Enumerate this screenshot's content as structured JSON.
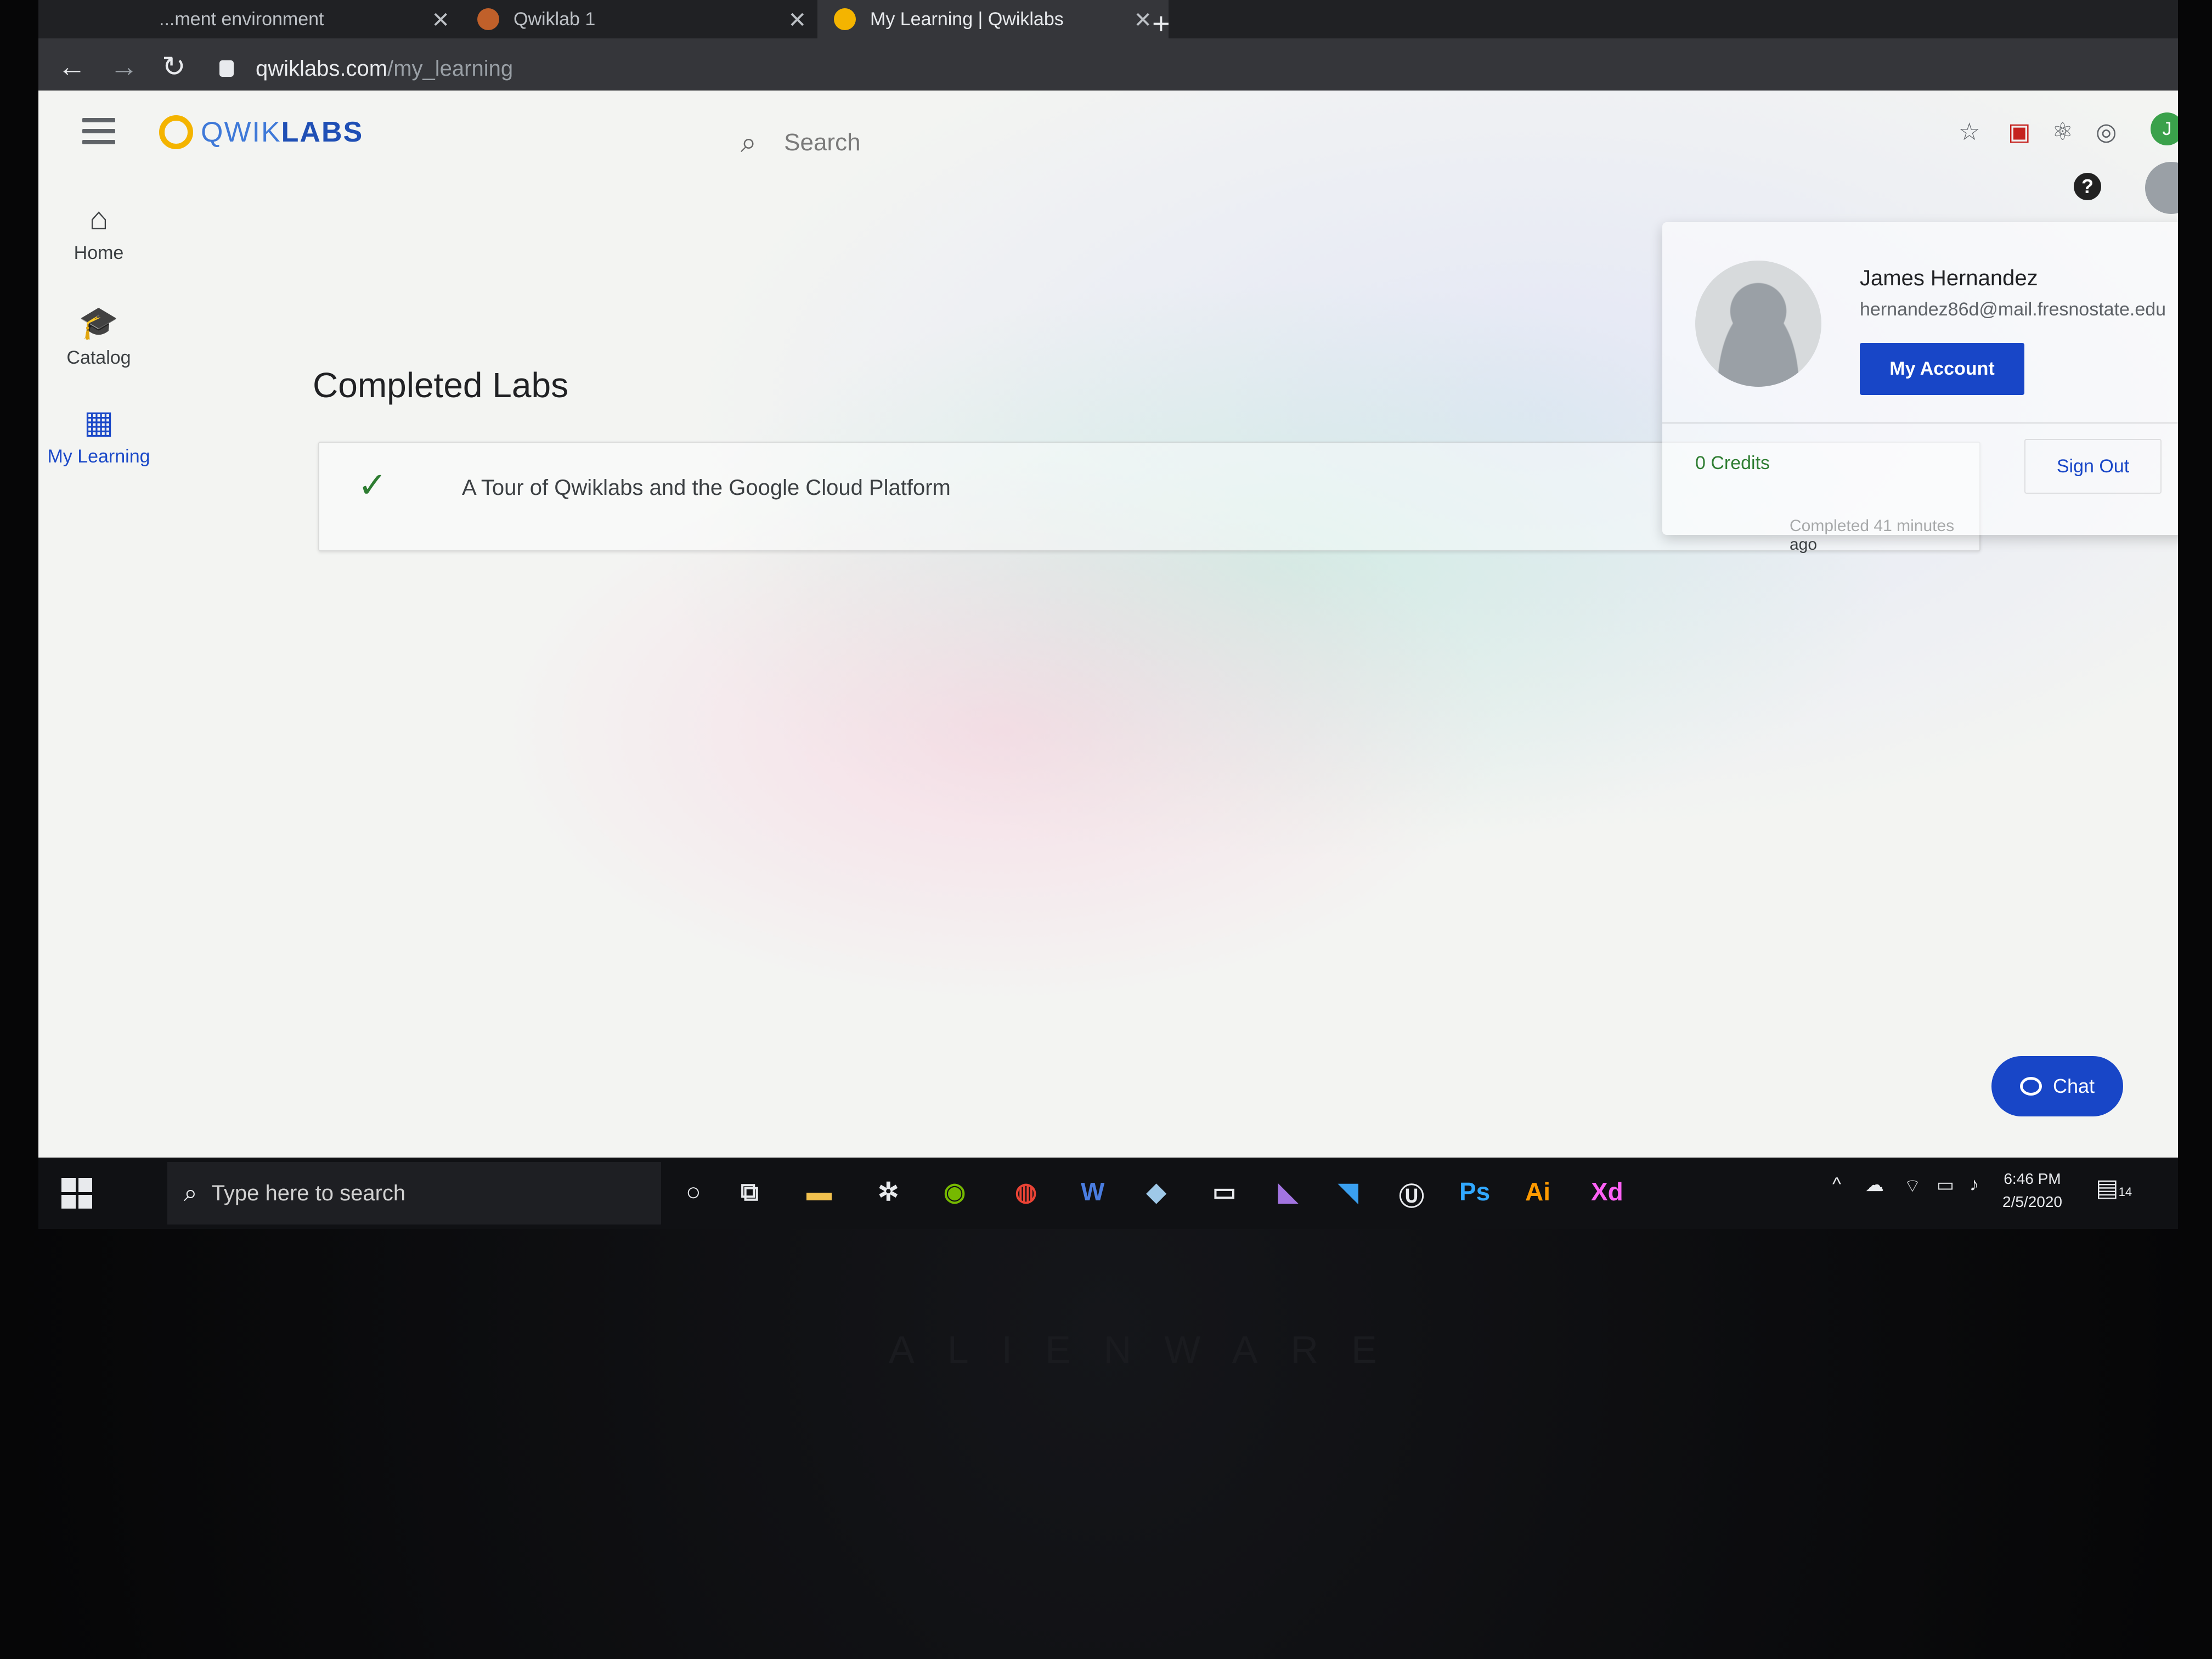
{
  "tabs": [
    {
      "label": "...ment environment",
      "close": "✕"
    },
    {
      "label": "Qwiklab 1",
      "close": "✕"
    },
    {
      "label": "My Learning | Qwiklabs",
      "close": "✕",
      "active": true
    }
  ],
  "new_tab": "+",
  "address": {
    "host": "qwiklabs.com",
    "path": "/my_learning"
  },
  "nav_buttons": {
    "back": "←",
    "forward": "→",
    "reload": "↻"
  },
  "window_controls": {
    "minimize": "—",
    "restore": "❐",
    "close": "✕"
  },
  "profile_initial": "J",
  "app": {
    "logo_light": "QWIK",
    "logo_bold": "LABS",
    "search_placeholder": "Search",
    "help": "?"
  },
  "sidenav": [
    {
      "icon": "home-icon",
      "glyph": "⌂",
      "label": "Home"
    },
    {
      "icon": "catalog-icon",
      "glyph": "🎓",
      "label": "Catalog"
    },
    {
      "icon": "calendar-icon",
      "glyph": "▦",
      "label": "My Learning",
      "active": true
    }
  ],
  "completed": {
    "heading": "Completed Labs",
    "labs": [
      {
        "title": "A Tour of Qwiklabs and the Google Cloud Platform",
        "status": "Completed 41 minutes ago"
      }
    ]
  },
  "account_menu": {
    "name": "James Hernandez",
    "email": "hernandez86d@mail.fresnostate.edu",
    "my_account": "My Account",
    "credits": "0 Credits",
    "sign_out": "Sign Out"
  },
  "chat_label": "Chat",
  "taskbar": {
    "search_placeholder": "Type here to search",
    "apps": [
      "cortana-icon",
      "task-view-icon",
      "file-explorer-icon",
      "app-icon",
      "nvidia-icon",
      "chrome-icon",
      "word-icon",
      "app-icon-2",
      "terminal-icon",
      "visual-studio-icon",
      "vscode-icon",
      "unreal-icon",
      "photoshop-icon",
      "illustrator-icon",
      "xd-icon"
    ],
    "word": "W",
    "photoshop": "Ps",
    "illustrator": "Ai",
    "xd": "Xd",
    "time": "6:46 PM",
    "date": "2/5/2020",
    "notifications": "14"
  },
  "bezel_brand": "ALIENWARE",
  "colors": {
    "brand_blue": "#1846c7",
    "success_green": "#2e7d32",
    "logo_yellow": "#f4b400"
  }
}
